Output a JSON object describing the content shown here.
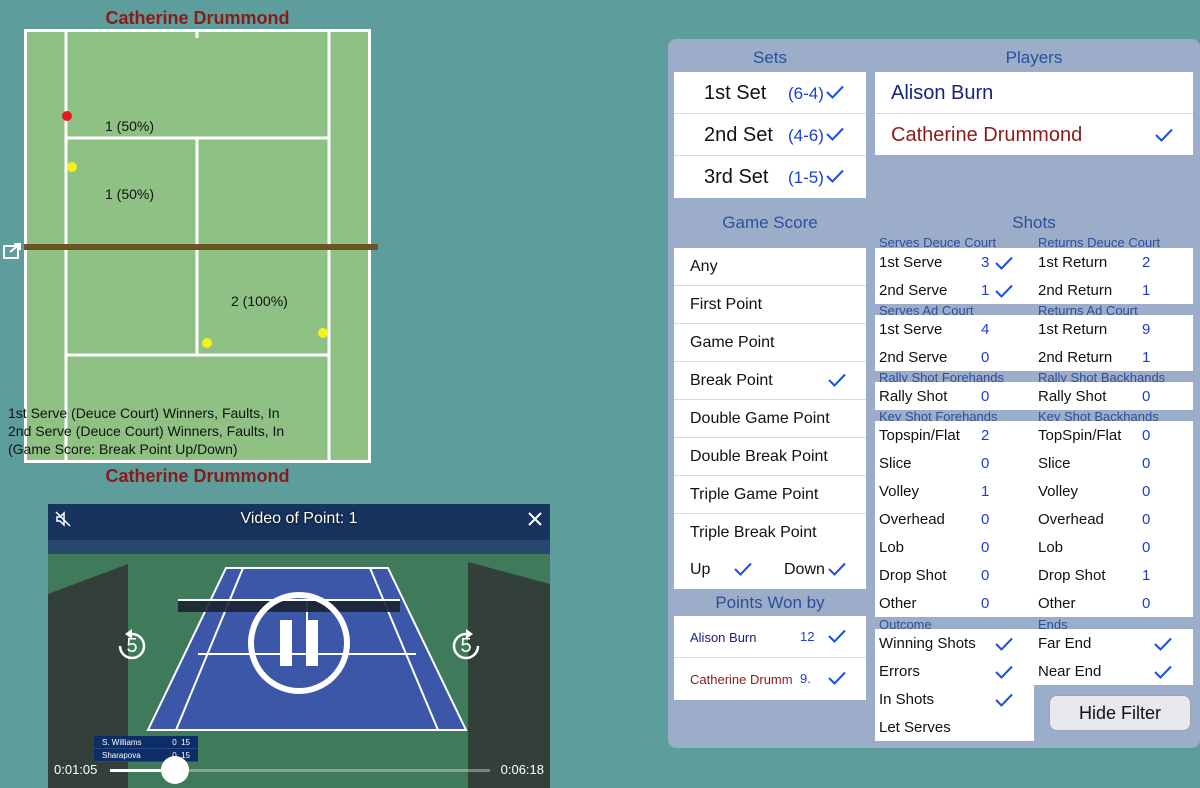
{
  "court": {
    "top_player": "Catherine Drummond",
    "bottom_player": "Catherine Drummond",
    "zone_labels": [
      "1 (50%)",
      "1 (50%)",
      "2 (100%)"
    ],
    "legend": [
      "1st Serve (Deuce Court) Winners, Faults, In",
      "2nd Serve (Deuce Court) Winners, Faults, In",
      "(Game Score: Break Point Up/Down)"
    ],
    "colors": {
      "grass": "#8fc185",
      "net": "#6b5424",
      "fault_dot": "#e8191c",
      "in_dot": "#f4f018"
    }
  },
  "video": {
    "title": "Video of Point: 1",
    "current_time": "0:01:05",
    "total_time": "0:06:18",
    "progress": 0.172,
    "skip_back": "5",
    "skip_forward": "5",
    "scoreboard": [
      {
        "name": "S. Williams",
        "games": "0",
        "points": "15"
      },
      {
        "name": "Sharapova",
        "games": "0",
        "points": "15"
      }
    ]
  },
  "panel": {
    "sets_header": "Sets",
    "players_header": "Players",
    "game_score_header": "Game Score",
    "shots_header": "Shots",
    "points_won_header": "Points Won by",
    "hide_filter": "Hide Filter",
    "sets": [
      {
        "label": "1st Set",
        "score": "(6-4)"
      },
      {
        "label": "2nd Set",
        "score": "(4-6)"
      },
      {
        "label": "3rd Set",
        "score": "(1-5)"
      }
    ],
    "players": [
      {
        "name": "Alison Burn",
        "color": "#1a237e",
        "checked": false
      },
      {
        "name": "Catherine Drummond",
        "color": "#8b1a1a",
        "checked": true
      }
    ],
    "game_scores": [
      {
        "label": "Any",
        "checked": false
      },
      {
        "label": "First Point",
        "checked": false
      },
      {
        "label": "Game Point",
        "checked": false
      },
      {
        "label": "Break Point",
        "checked": true
      },
      {
        "label": "Double Game Point",
        "checked": false
      },
      {
        "label": "Double Break Point",
        "checked": false
      },
      {
        "label": "Triple Game Point",
        "checked": false
      },
      {
        "label": "Triple Break Point",
        "checked": false
      }
    ],
    "up_label": "Up",
    "down_label": "Down",
    "points_won": [
      {
        "name": "Alison Burn",
        "count": "12",
        "color": "#1a237e"
      },
      {
        "name": "Catherine Drumm",
        "count": "9.",
        "color": "#8b1a1a"
      }
    ],
    "shots": {
      "serves_deuce": "Serves Deuce Court",
      "returns_deuce": "Returns Deuce Court",
      "serves_ad": "Serves Ad Court",
      "returns_ad": "Returns Ad Court",
      "rally_fh": "Rally Shot Forehands",
      "rally_bh": "Rally Shot Backhands",
      "key_fh": "Key Shot Forehands",
      "key_bh": "Key Shot Backhands",
      "outcome": "Outcome",
      "ends": "Ends",
      "deuce_left": [
        {
          "label": "1st Serve",
          "value": "3",
          "checked": true
        },
        {
          "label": "2nd Serve",
          "value": "1",
          "checked": true
        }
      ],
      "deuce_right": [
        {
          "label": "1st Return",
          "value": "2"
        },
        {
          "label": "2nd Return",
          "value": "1"
        }
      ],
      "ad_left": [
        {
          "label": "1st Serve",
          "value": "4"
        },
        {
          "label": "2nd Serve",
          "value": "0"
        }
      ],
      "ad_right": [
        {
          "label": "1st Return",
          "value": "9"
        },
        {
          "label": "2nd Return",
          "value": "1"
        }
      ],
      "rally_left": {
        "label": "Rally Shot",
        "value": "0"
      },
      "rally_right": {
        "label": "Rally Shot",
        "value": "0"
      },
      "key_left": [
        {
          "label": "Topspin/Flat",
          "value": "2"
        },
        {
          "label": "Slice",
          "value": "0"
        },
        {
          "label": "Volley",
          "value": "1"
        },
        {
          "label": "Overhead",
          "value": "0"
        },
        {
          "label": "Lob",
          "value": "0"
        },
        {
          "label": "Drop Shot",
          "value": "0"
        },
        {
          "label": "Other",
          "value": "0"
        }
      ],
      "key_right": [
        {
          "label": "TopSpin/Flat",
          "value": "0"
        },
        {
          "label": "Slice",
          "value": "0"
        },
        {
          "label": "Volley",
          "value": "0"
        },
        {
          "label": "Overhead",
          "value": "0"
        },
        {
          "label": "Lob",
          "value": "0"
        },
        {
          "label": "Drop Shot",
          "value": "1"
        },
        {
          "label": "Other",
          "value": "0"
        }
      ],
      "outcome_items": [
        {
          "label": "Winning Shots",
          "checked": true
        },
        {
          "label": "Errors",
          "checked": true
        },
        {
          "label": "In Shots",
          "checked": true
        },
        {
          "label": "Let Serves",
          "checked": false
        }
      ],
      "ends_items": [
        {
          "label": "Far End",
          "checked": true
        },
        {
          "label": "Near End",
          "checked": true
        }
      ]
    }
  }
}
